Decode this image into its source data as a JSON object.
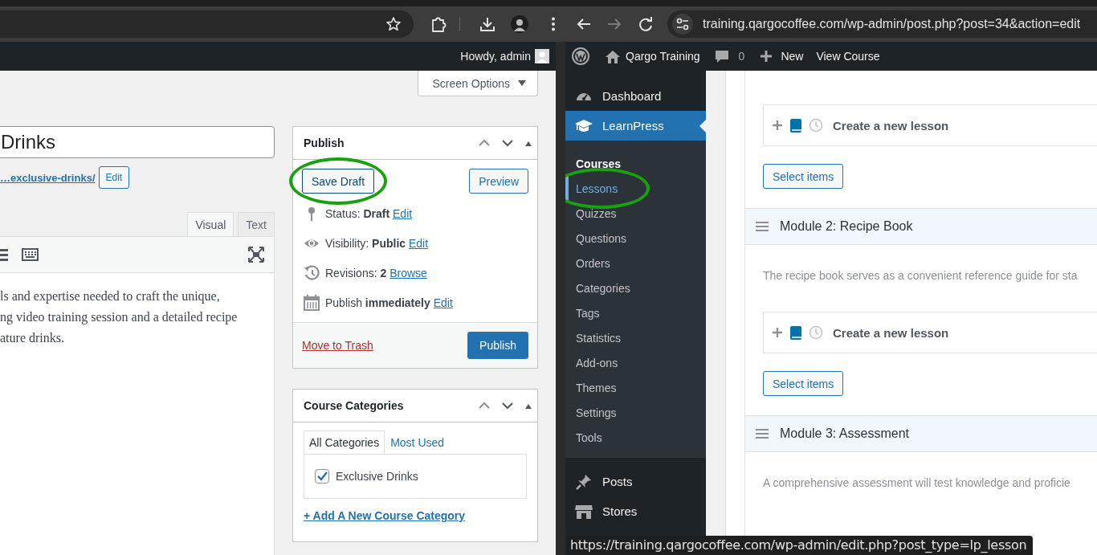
{
  "left_window": {
    "admin_bar": {
      "greeting": "Howdy, admin"
    },
    "screen_options": "Screen Options",
    "post_title": "Drinks",
    "permalink": {
      "link": "…exclusive-drinks/",
      "button": "Edit"
    },
    "editor_tabs": [
      {
        "label": "Visual",
        "selected": true
      },
      {
        "label": "Text",
        "selected": false
      }
    ],
    "editor_lines": [
      "ls and expertise needed to craft the unique,",
      "ng video training session and a detailed recipe",
      "ature drinks."
    ],
    "publish": {
      "title": "Publish",
      "save_draft": {
        "label": "Save Draft",
        "circled": true
      },
      "preview": "Preview",
      "meta": [
        {
          "kind": "status",
          "text": "Status: **Draft**",
          "link": "Edit"
        },
        {
          "kind": "visibility",
          "text": "Visibility: **Public**",
          "link": "Edit"
        },
        {
          "kind": "revisions",
          "text": "Revisions: **2**",
          "link": "Browse"
        },
        {
          "kind": "schedule",
          "text": "Publish **immediately**",
          "link": "Edit"
        }
      ],
      "trash": "Move to Trash",
      "publish_button": "Publish"
    },
    "course_categories": {
      "title": "Course Categories",
      "tabs": [
        {
          "label": "All Categories",
          "selected": true
        },
        {
          "label": "Most Used",
          "selected": false
        }
      ],
      "items": [
        {
          "label": "Exclusive Drinks",
          "checked": true
        }
      ],
      "add_link": "+ Add A New Course Category"
    }
  },
  "right_window": {
    "url": "training.qargocoffee.com/wp-admin/post.php?post=34&action=edit",
    "admin_bar": {
      "site": "Qargo Training",
      "comments": "0",
      "new": "New",
      "view": "View Course"
    },
    "menu": [
      {
        "label": "Dashboard",
        "selected": false
      },
      {
        "label": "LearnPress",
        "selected": true,
        "children": [
          {
            "label": "Courses",
            "selected": true,
            "hovered": false,
            "circled": false
          },
          {
            "label": "Lessons",
            "selected": false,
            "hovered": true,
            "circled": true
          },
          {
            "label": "Quizzes",
            "selected": false,
            "hovered": false,
            "circled": false
          },
          {
            "label": "Questions",
            "selected": false,
            "hovered": false,
            "circled": false
          },
          {
            "label": "Orders",
            "selected": false,
            "hovered": false,
            "circled": false
          },
          {
            "label": "Categories",
            "selected": false,
            "hovered": false,
            "circled": false
          },
          {
            "label": "Tags",
            "selected": false,
            "hovered": false,
            "circled": false
          },
          {
            "label": "Statistics",
            "selected": false,
            "hovered": false,
            "circled": false
          },
          {
            "label": "Add-ons",
            "selected": false,
            "hovered": false,
            "circled": false
          },
          {
            "label": "Themes",
            "selected": false,
            "hovered": false,
            "circled": false
          },
          {
            "label": "Settings",
            "selected": false,
            "hovered": false,
            "circled": false
          },
          {
            "label": "Tools",
            "selected": false,
            "hovered": false,
            "circled": false
          }
        ]
      },
      {
        "label": "Posts",
        "selected": false
      },
      {
        "label": "Stores",
        "selected": false
      }
    ],
    "sections": [
      {
        "lesson_placeholder": "Create a new lesson",
        "button": "Select items"
      },
      {
        "title": "Module 2: Recipe Book",
        "description": "The recipe book serves as a convenient reference guide for sta",
        "lesson_placeholder": "Create a new lesson",
        "button": "Select items"
      },
      {
        "title": "Module 3: Assessment",
        "description": "A comprehensive assessment will test knowledge and proficie"
      }
    ],
    "status_tooltip": "https://training.qargocoffee.com/wp-admin/edit.php?post_type=lp_lesson"
  }
}
